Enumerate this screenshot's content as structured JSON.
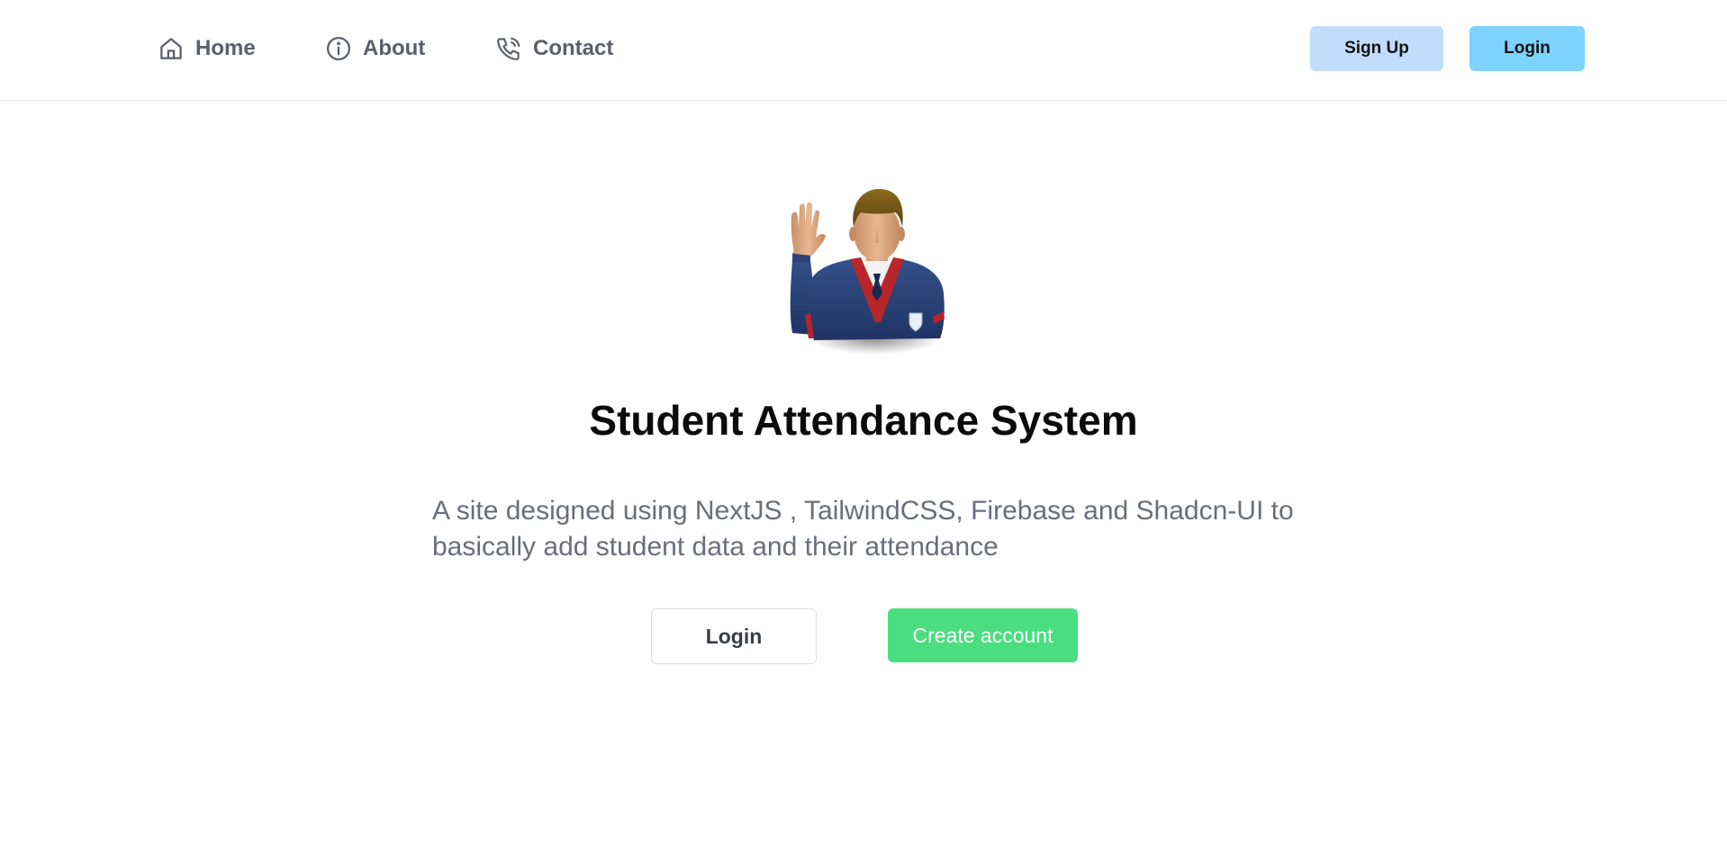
{
  "nav": {
    "items": [
      {
        "label": "Home",
        "icon": "home-icon"
      },
      {
        "label": "About",
        "icon": "info-icon"
      },
      {
        "label": "Contact",
        "icon": "phone-icon"
      }
    ],
    "signup_label": "Sign Up",
    "login_label": "Login"
  },
  "hero": {
    "image": "student-avatar",
    "title": "Student Attendance System",
    "description": "A site designed using NextJS , TailwindCSS, Firebase and Shadcn-UI to basically add student data and their attendance",
    "login_label": "Login",
    "create_label": "Create account"
  },
  "colors": {
    "signup_bg": "#c2dcfd",
    "login_bg": "#7dd3fb",
    "create_bg": "#4ade80",
    "text_muted": "#6a6e79"
  }
}
